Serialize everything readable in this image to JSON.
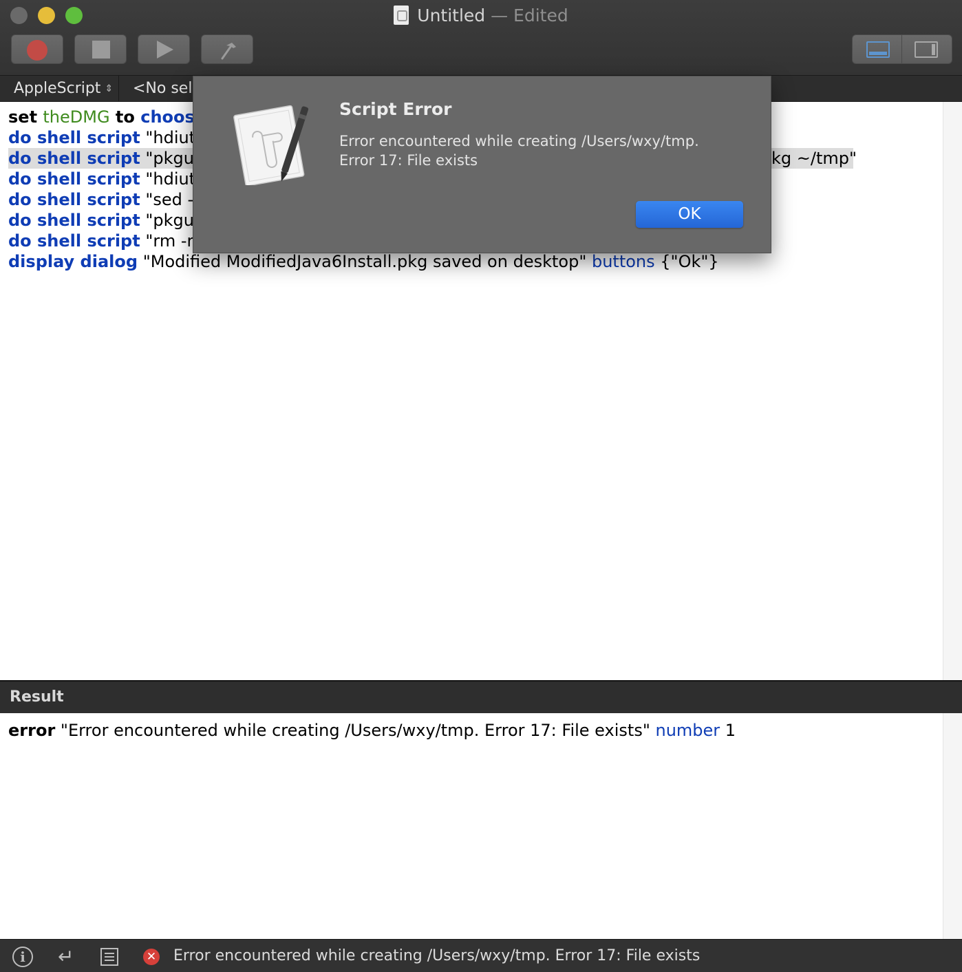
{
  "window": {
    "title": "Untitled",
    "edited_suffix": "— Edited"
  },
  "toolbar": {
    "buttons": [
      {
        "name": "record",
        "icon": "record-icon"
      },
      {
        "name": "stop",
        "icon": "stop-icon"
      },
      {
        "name": "run",
        "icon": "play-icon"
      },
      {
        "name": "compile",
        "icon": "hammer-icon"
      }
    ],
    "view_segments": [
      "bottom-pane-view",
      "side-pane-view"
    ]
  },
  "navbar": {
    "language": "AppleScript",
    "selection": "<No sele"
  },
  "editor": {
    "lines": [
      {
        "segments": [
          {
            "t": "set ",
            "c": "kw"
          },
          {
            "t": "theDMG",
            "c": "var"
          },
          {
            "t": " to ",
            "c": "kw"
          },
          {
            "t": "choos",
            "c": "cmd"
          }
        ]
      },
      {
        "segments": [
          {
            "t": "do shell script",
            "c": "cmd"
          },
          {
            "t": " \"hdiut",
            "c": "str"
          }
        ]
      },
      {
        "segments": [
          {
            "t": "do shell script",
            "c": "cmd"
          },
          {
            "t": " \"pkgu",
            "c": "str"
          }
        ],
        "tail": "kg ~/tmp\"",
        "highlighted": true
      },
      {
        "segments": [
          {
            "t": "do shell script",
            "c": "cmd"
          },
          {
            "t": " \"hdiut",
            "c": "str"
          }
        ]
      },
      {
        "segments": [
          {
            "t": "do shell script",
            "c": "cmd"
          },
          {
            "t": " \"sed -",
            "c": "str"
          }
        ]
      },
      {
        "segments": [
          {
            "t": "do shell script",
            "c": "cmd"
          },
          {
            "t": " \"pkgu",
            "c": "str"
          }
        ]
      },
      {
        "segments": [
          {
            "t": "do shell script",
            "c": "cmd"
          },
          {
            "t": " \"rm -r",
            "c": "str"
          }
        ]
      },
      {
        "segments": [
          {
            "t": "display dialog",
            "c": "cmd"
          },
          {
            "t": " \"Modified ModifiedJava6Install.pkg saved on desktop\" ",
            "c": "str"
          },
          {
            "t": "buttons",
            "c": "param"
          },
          {
            "t": " {\"Ok\"}",
            "c": "str"
          }
        ]
      }
    ]
  },
  "result": {
    "header": "Result",
    "keyword": "error",
    "message": " \"Error encountered while creating /Users/wxy/tmp. Error 17: File exists\" ",
    "param": "number",
    "value": " 1"
  },
  "statusbar": {
    "message": "Error encountered while creating /Users/wxy/tmp. Error 17: File exists"
  },
  "dialog": {
    "title": "Script Error",
    "line1": "Error encountered while creating /Users/wxy/tmp.",
    "line2": "Error 17: File exists",
    "ok_label": "OK"
  },
  "colors": {
    "keyword": "#000000",
    "command": "#0f3db5",
    "variable": "#3f8b1e",
    "ok_button": "#2a6fe0"
  }
}
